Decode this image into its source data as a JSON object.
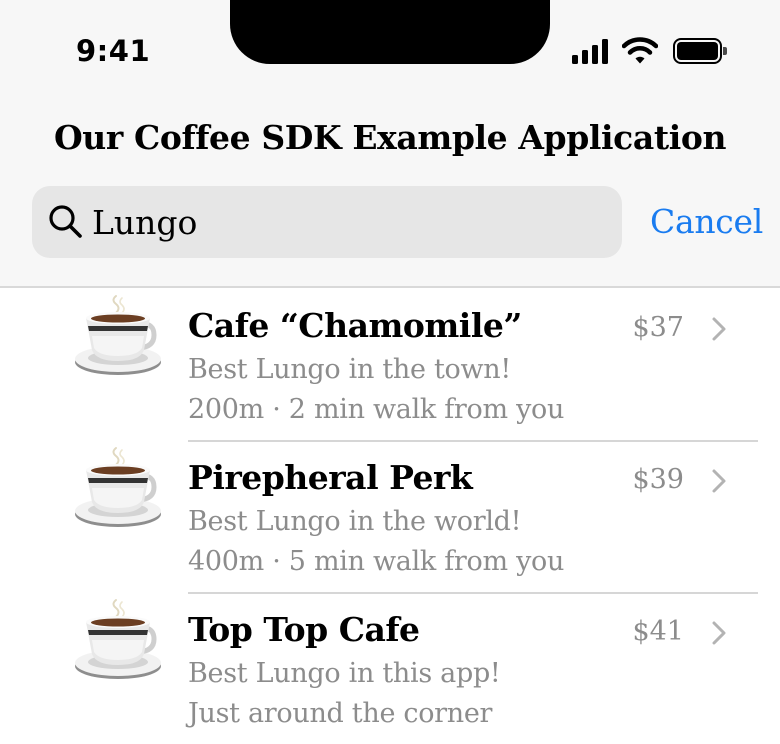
{
  "status_bar": {
    "time": "9:41",
    "icons": [
      "cellular-signal-icon",
      "wifi-icon",
      "battery-icon"
    ]
  },
  "nav": {
    "title": "Our Coffee SDK Example Application"
  },
  "search": {
    "value": "Lungo",
    "icon": "search-icon",
    "cancel_label": "Cancel"
  },
  "colors": {
    "accent": "#1a7cf0",
    "secondary_text": "#8c8c8c",
    "header_bg": "#f7f7f7",
    "search_bg": "#e6e6e6"
  },
  "results": [
    {
      "name": "Cafe “Chamomile”",
      "description": "Best Lungo in the town!",
      "distance": "200m · 2 min walk from you",
      "price": "$37",
      "icon": "coffee-cup-icon"
    },
    {
      "name": "Pirepheral Perk",
      "description": "Best Lungo in the world!",
      "distance": "400m · 5 min walk from you",
      "price": "$39",
      "icon": "coffee-cup-icon"
    },
    {
      "name": "Top Top Cafe",
      "description": "Best Lungo in this app!",
      "distance": "Just around the corner",
      "price": "$41",
      "icon": "coffee-cup-icon"
    }
  ]
}
